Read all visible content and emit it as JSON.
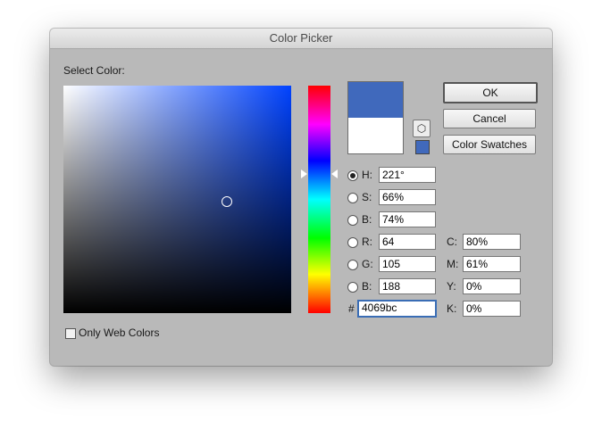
{
  "window": {
    "title": "Color Picker"
  },
  "select_label": "Select Color:",
  "buttons": {
    "ok": "OK",
    "cancel": "Cancel",
    "swatches": "Color Swatches"
  },
  "colors": {
    "new": "#4069bc",
    "current": "#ffffff",
    "small_swatch": "#4069bc"
  },
  "icons": {
    "cube": "cube-icon"
  },
  "hsb": [
    {
      "label": "H:",
      "value": "221°",
      "selected": true
    },
    {
      "label": "S:",
      "value": "66%",
      "selected": false
    },
    {
      "label": "B:",
      "value": "74%",
      "selected": false
    }
  ],
  "rgb": [
    {
      "label": "R:",
      "value": "64",
      "selected": false
    },
    {
      "label": "G:",
      "value": "105",
      "selected": false
    },
    {
      "label": "B:",
      "value": "188",
      "selected": false
    }
  ],
  "hex": {
    "label": "#",
    "value": "4069bc"
  },
  "cmyk": [
    {
      "label": "C:",
      "value": "80%"
    },
    {
      "label": "M:",
      "value": "61%"
    },
    {
      "label": "Y:",
      "value": "0%"
    },
    {
      "label": "K:",
      "value": "0%"
    }
  ],
  "only_web_colors": {
    "label": "Only Web Colors",
    "checked": false
  }
}
